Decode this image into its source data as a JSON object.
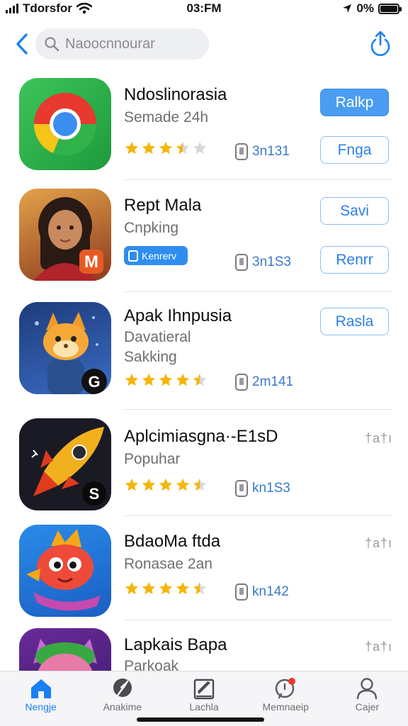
{
  "status_bar": {
    "carrier": "Tdorsfor",
    "time": "03:FM",
    "battery": "0%"
  },
  "search": {
    "placeholder": "Naoocnnourar"
  },
  "apps": [
    {
      "title": "Ndoslinorasia",
      "subtitle": "Semade 24h",
      "rating": 3.5,
      "size": "3n131",
      "primary_button": "Ralkp",
      "secondary_button": "Fnga",
      "icon": "chrome-like-icon"
    },
    {
      "title": "Rept Mala",
      "subtitle": "Cnpking",
      "badge": "Kenrerv",
      "size": "3n1S3",
      "primary_button": "Savi",
      "secondary_button": "Renrr",
      "icon": "girl-portrait-icon"
    },
    {
      "title": "Apak Ihnpusia",
      "subtitle": "Davatieral",
      "subtitle2": "Sakking",
      "rating": 4.5,
      "size": "2m141",
      "primary_button": "Rasla",
      "icon": "fox-character-icon"
    },
    {
      "title": "Aplcimiasgna·-E1sD",
      "subtitle": "Popuhar",
      "rating": 4.5,
      "size": "kn1S3",
      "more": "†a†ı",
      "icon": "rocket-icon"
    },
    {
      "title": "BdaoMa ftda",
      "subtitle": "Ronasae 2an",
      "rating": 4.5,
      "size": "kn142",
      "more": "†a†ı",
      "icon": "bird-character-icon"
    },
    {
      "title": "Lapkais Bapa",
      "subtitle": "Parkoak",
      "more": "†a†ı",
      "icon": "cat-character-icon"
    }
  ],
  "tabs": [
    {
      "label": "Nengje",
      "icon": "home-icon",
      "active": true
    },
    {
      "label": "Anakime",
      "icon": "feather-icon",
      "active": false
    },
    {
      "label": "Lachla",
      "icon": "edit-square-icon",
      "active": false
    },
    {
      "label": "Memnaeip",
      "icon": "notification-icon",
      "active": false
    },
    {
      "label": "Cajer",
      "icon": "person-icon",
      "active": false
    }
  ],
  "colors": {
    "accent": "#1a7ff5",
    "star": "#f5b50a",
    "button_fill": "#4a9df0"
  }
}
